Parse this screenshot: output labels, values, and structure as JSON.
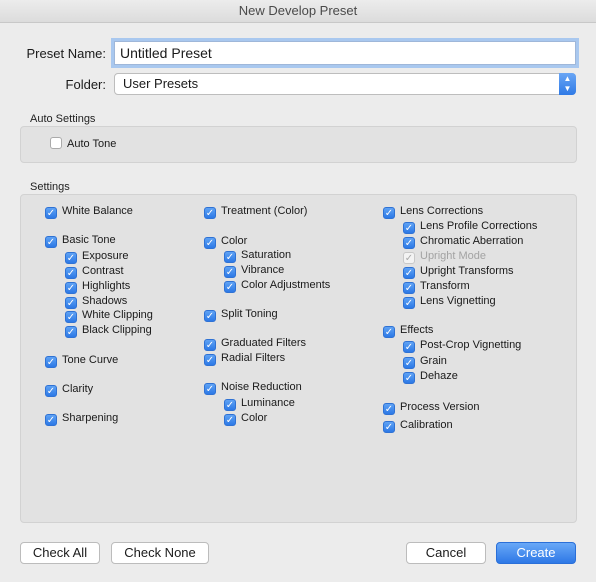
{
  "window": {
    "title": "New Develop Preset"
  },
  "preset_name": {
    "label": "Preset Name:",
    "value": "Untitled Preset"
  },
  "folder": {
    "label": "Folder:",
    "value": "User Presets"
  },
  "auto_settings": {
    "title": "Auto Settings",
    "auto_tone": "Auto Tone"
  },
  "settings": {
    "title": "Settings",
    "col1": {
      "white_balance": "White Balance",
      "basic_tone": "Basic Tone",
      "exposure": "Exposure",
      "contrast": "Contrast",
      "highlights": "Highlights",
      "shadows": "Shadows",
      "white_clipping": "White Clipping",
      "black_clipping": "Black Clipping",
      "tone_curve": "Tone Curve",
      "clarity": "Clarity",
      "sharpening": "Sharpening"
    },
    "col2": {
      "treatment": "Treatment (Color)",
      "color": "Color",
      "saturation": "Saturation",
      "vibrance": "Vibrance",
      "color_adjustments": "Color Adjustments",
      "split_toning": "Split Toning",
      "graduated_filters": "Graduated Filters",
      "radial_filters": "Radial Filters",
      "noise_reduction": "Noise Reduction",
      "luminance": "Luminance",
      "nr_color": "Color"
    },
    "col3": {
      "lens_corrections": "Lens Corrections",
      "lens_profile": "Lens Profile Corrections",
      "chromatic_aberration": "Chromatic Aberration",
      "upright_mode": "Upright Mode",
      "upright_transforms": "Upright Transforms",
      "transform": "Transform",
      "lens_vignetting": "Lens Vignetting",
      "effects": "Effects",
      "post_crop": "Post-Crop Vignetting",
      "grain": "Grain",
      "dehaze": "Dehaze",
      "process_version": "Process Version",
      "calibration": "Calibration"
    }
  },
  "buttons": {
    "check_all": "Check All",
    "check_none": "Check None",
    "cancel": "Cancel",
    "create": "Create"
  },
  "colors": {
    "accent": "#2d79e6",
    "panel": "#e2e2e2",
    "window": "#ececec"
  }
}
